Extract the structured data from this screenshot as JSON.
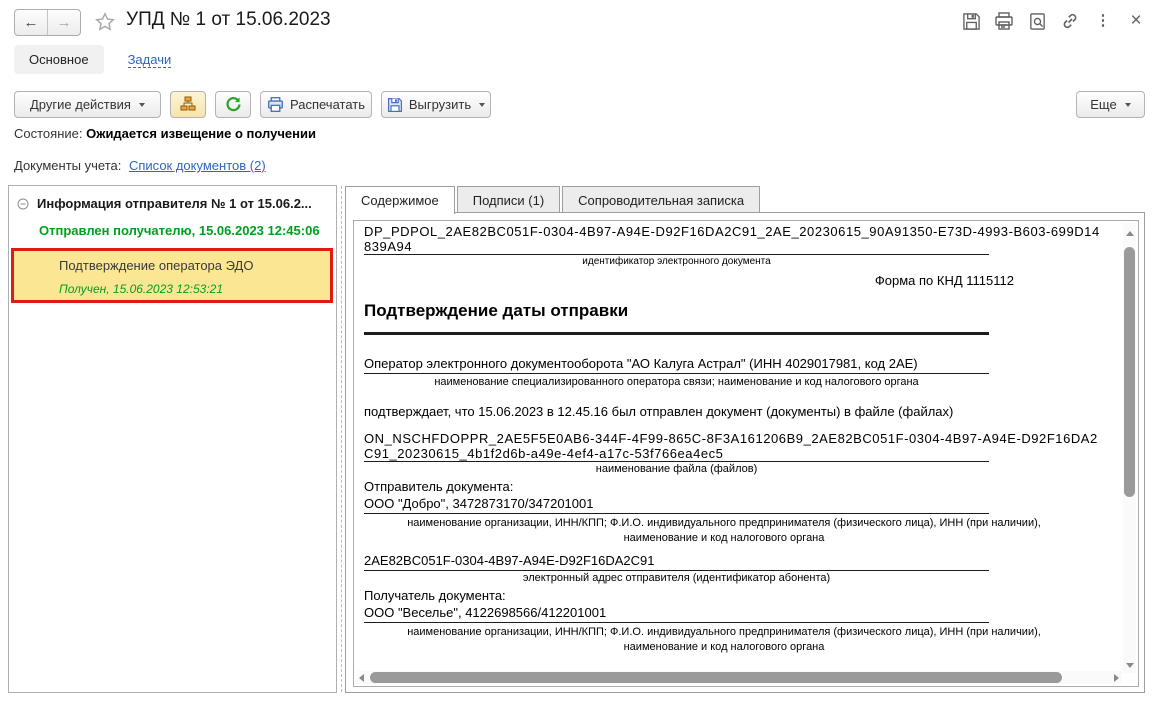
{
  "window": {
    "title": "УПД № 1 от 15.06.2023"
  },
  "header": {
    "icons": [
      "back-arrow",
      "forward-arrow",
      "favorite-star",
      "save",
      "print",
      "preview",
      "link",
      "more-kebab",
      "close"
    ]
  },
  "nav_tabs": {
    "main": "Основное",
    "tasks": "Задачи"
  },
  "toolbar": {
    "other_actions": "Другие действия",
    "print_label": "Распечатать",
    "export_label": "Выгрузить",
    "more_label": "Еще"
  },
  "status": {
    "label": "Состояние:",
    "value": "Ожидается извещение о получении"
  },
  "accounting_docs": {
    "label": "Документы учета:",
    "link": "Список документов (2)"
  },
  "tree": {
    "root": "Информация отправителя № 1 от 15.06.2...",
    "root_status": "Отправлен получателю, 15.06.2023 12:45:06",
    "selected": {
      "title": "Подтверждение оператора ЭДО",
      "status": "Получен, 15.06.2023 12:53:21"
    }
  },
  "content_tabs": [
    "Содержимое",
    "Подписи (1)",
    "Сопроводительная записка"
  ],
  "document": {
    "identifier": "DP_PDPOL_2AE82BC051F-0304-4B97-A94E-D92F16DA2C91_2AE_20230615_90A91350-E73D-4993-B603-699D14839A94",
    "identifier_caption": "идентификатор электронного документа",
    "form_code": "Форма по КНД 1115112",
    "heading": "Подтверждение даты отправки",
    "operator": "Оператор электронного документооборота \"АО Калуга Астрал\" (ИНН 4029017981, код 2АЕ)",
    "operator_caption": "наименование специализированного оператора связи; наименование и код налогового органа",
    "confirm_text": "подтверждает, что 15.06.2023 в 12.45.16 был отправлен документ (документы) в файле (файлах)",
    "file_name": "ON_NSCHFDOPPR_2AE5F5E0AB6-344F-4F99-865C-8F3A161206B9_2AE82BC051F-0304-4B97-A94E-D92F16DA2C91_20230615_4b1f2d6b-a49e-4ef4-a17c-53f766ea4ec5",
    "file_caption": "наименование файла (файлов)",
    "sender_label": "Отправитель документа:",
    "sender": "ООО \"Добро\", 3472873170/347201001",
    "org_caption": "наименование организации, ИНН/КПП; Ф.И.О. индивидуального предпринимателя (физического лица), ИНН (при наличии), наименование и код налогового органа",
    "sender_address": "2AE82BC051F-0304-4B97-A94E-D92F16DA2C91",
    "sender_address_caption": "электронный адрес отправителя (идентификатор абонента)",
    "receiver_label": "Получатель документа:",
    "receiver": "ООО \"Веселье\", 4122698566/412201001"
  },
  "colors": {
    "status_green": "#00a01e",
    "selection_yellow": "#fbe694",
    "highlight_red": "#e01b14",
    "link_blue": "#2e66c0"
  }
}
